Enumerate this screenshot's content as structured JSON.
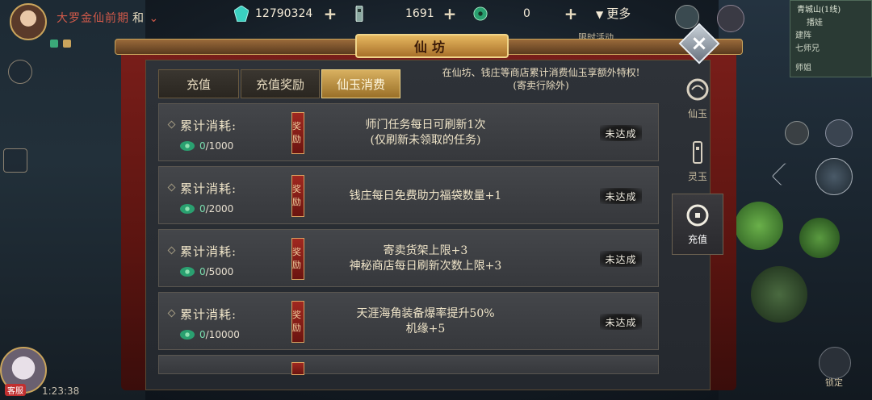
{
  "player": {
    "realm": "大罗金仙前期",
    "realm_suffix": "和",
    "tag": "客服",
    "clock": "1:23:38"
  },
  "currencies": [
    {
      "icon": "xianyu-gem-icon",
      "value": "12790324",
      "color": "#3ad0c0"
    },
    {
      "icon": "lingyu-token-icon",
      "value": "1691",
      "color": "#a8d0c8"
    },
    {
      "icon": "jade-coin-icon",
      "value": "0",
      "color": "#3ab080"
    }
  ],
  "more_label": "更多",
  "events": {
    "limited_label": "限时活动"
  },
  "minimap": {
    "line1": "青城山(1线)",
    "line2": "播娃",
    "line3": "建阵",
    "line4": "七师兄",
    "line5": "师姐"
  },
  "panel": {
    "title": "仙坊",
    "notice_line1": "在仙坊、钱庄等商店累计消费仙玉享额外特权!",
    "notice_line2": "(寄卖行除外)",
    "tabs": [
      {
        "label": "充值",
        "active": false
      },
      {
        "label": "充值奖励",
        "active": false
      },
      {
        "label": "仙玉消费",
        "active": true
      }
    ],
    "side_tabs": [
      {
        "label": "仙玉",
        "icon": "xianyu-icon",
        "active": false
      },
      {
        "label": "灵玉",
        "icon": "lingyu-icon",
        "active": false
      },
      {
        "label": "充值",
        "icon": "recharge-icon",
        "active": true
      }
    ],
    "rows": [
      {
        "label": "累计消耗:",
        "current": "0",
        "target": "/1000",
        "reward_tag": "奖励",
        "desc_line1": "师门任务每日可刷新1次",
        "desc_line2": "(仅刷新未领取的任务)",
        "status": "未达成"
      },
      {
        "label": "累计消耗:",
        "current": "0",
        "target": "/2000",
        "reward_tag": "奖励",
        "desc_line1": "钱庄每日免费助力福袋数量+1",
        "desc_line2": "",
        "status": "未达成"
      },
      {
        "label": "累计消耗:",
        "current": "0",
        "target": "/5000",
        "reward_tag": "奖励",
        "desc_line1": "寄卖货架上限+3",
        "desc_line2": "神秘商店每日刷新次数上限+3",
        "status": "未达成"
      },
      {
        "label": "累计消耗:",
        "current": "0",
        "target": "/10000",
        "reward_tag": "奖励",
        "desc_line1": "天涯海角装备爆率提升50%",
        "desc_line2": "机缘+5",
        "status": "未达成"
      }
    ]
  },
  "bottom_right_label": "锁定"
}
